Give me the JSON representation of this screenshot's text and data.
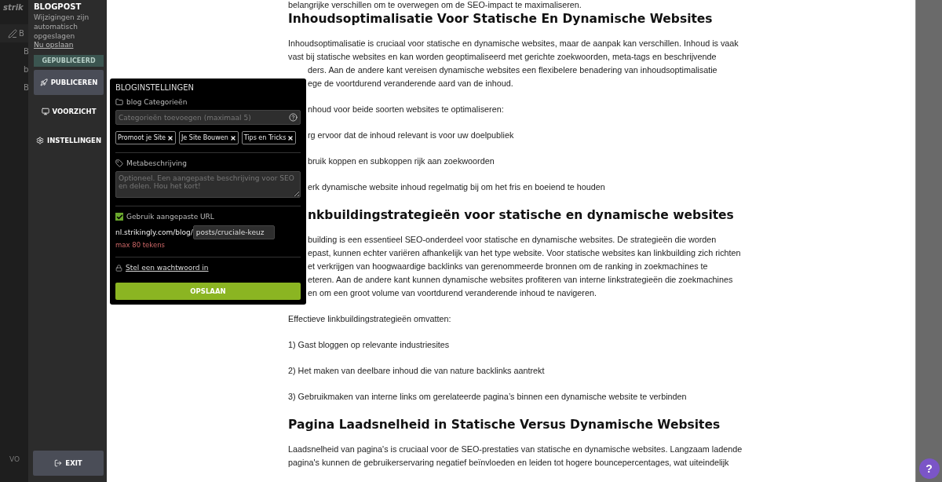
{
  "left_strip": {
    "logo": "strik",
    "items": [
      {
        "kind": "pen",
        "text": "B"
      },
      {
        "kind": "plain",
        "text": "B"
      },
      {
        "kind": "plain",
        "text": "b"
      },
      {
        "kind": "plain",
        "text": "B"
      }
    ],
    "bottom": "VO"
  },
  "sidebar": {
    "title": "BLOGPOST",
    "status": "Wijzigingen zijn automatisch opgeslagen",
    "save_link": "Nu opslaan",
    "badge": "GEPUBLICEERD",
    "buttons": [
      {
        "kind": "publish",
        "label": "PUBLICEREN"
      },
      {
        "kind": "preview",
        "label": "VOORZICHT"
      },
      {
        "kind": "settings",
        "label": "INSTELLINGEN"
      }
    ],
    "exit": "EXIT"
  },
  "popover": {
    "title": "BLOGINSTELLINGEN",
    "categories_label": "blog Categorieën",
    "categories_placeholder": "Categorieën toevoegen (maximaal 5)",
    "tags": [
      "Promoot je Site",
      "Je Site Bouwen",
      "Tips en Tricks"
    ],
    "meta_label": "Metabeschrijving",
    "meta_placeholder": "Optioneel. Een aangepaste beschrijving voor SEO en delen. Hou het kort!",
    "custom_url": {
      "label": "Gebruik aangepaste URL",
      "checked": true
    },
    "url_prefix": "nl.strikingly.com/blog/",
    "url_value": "posts/cruciale-keuz",
    "url_hint": "max 80 tekens",
    "password_link": "Stel een wachtwoord in",
    "save_button": "OPSLAAN"
  },
  "article": [
    {
      "kind": "para",
      "lines": [
        {
          "text": "belangrijke verschillen om te overwegen om de SEO-impact te maximaliseren."
        }
      ]
    },
    {
      "kind": "heading",
      "lines": [
        {
          "text": "Inhoudsoptimalisatie Voor Statische En Dynamische Websites"
        }
      ]
    },
    {
      "kind": "para",
      "lines": [
        {
          "text": "Inhoudsoptimalisatie is cruciaal voor statische en dynamische websites, maar de aanpak kan verschillen. Inhoud is vaak"
        },
        {
          "text": "vast bij statische websites en kan worden geoptimaliseerd met gerichte zoekwoorden, meta-tags en beschrijvende"
        },
        {
          "text": "ders. Aan de andere kant vereisen dynamische websites een flexibelere benadering van inhoudsoptimalisatie",
          "covered": true
        },
        {
          "text": "ege de voortdurend veranderende aard van de inhoud.",
          "covered": true
        }
      ]
    },
    {
      "kind": "para",
      "lines": [
        {
          "text": "nhoud voor beide soorten websites te optimaliseren:",
          "covered": true
        }
      ]
    },
    {
      "kind": "para",
      "lines": [
        {
          "text": "rg ervoor dat de inhoud relevant is voor uw doelpubliek",
          "covered": true
        }
      ]
    },
    {
      "kind": "para",
      "lines": [
        {
          "text": "bruik koppen en subkoppen rijk aan zoekwoorden",
          "covered": true
        }
      ]
    },
    {
      "kind": "para",
      "lines": [
        {
          "text": "erk dynamische website inhoud regelmatig bij om het fris en boeiend te houden",
          "covered": true
        }
      ]
    },
    {
      "kind": "heading",
      "lines": [
        {
          "text": "nkbuildingstrategieën voor statische en dynamische websites",
          "covered": true
        }
      ]
    },
    {
      "kind": "para",
      "lines": [
        {
          "text": "building is een essentieel SEO-onderdeel voor statische en dynamische websites. De strategieën die worden",
          "covered": true
        },
        {
          "text": "epast, kunnen echter variëren afhankelijk van het type website. Voor statische websites kan linkbuilding zich richten",
          "covered": true
        },
        {
          "text": "et verkrijgen van hoogwaardige backlinks van gerenommeerde bronnen om de ranking in zoekmachines te",
          "covered": true
        },
        {
          "text": "eteren. Aan de andere kant kunnen dynamische websites profiteren van interne linkstrategieën die zoekmachines",
          "covered": true
        },
        {
          "text": "en om een groot volume van voortdurend veranderende inhoud te navigeren.",
          "covered": true
        }
      ]
    },
    {
      "kind": "para",
      "lines": [
        {
          "text": "Effectieve linkbuildingstrategieën omvatten:"
        }
      ]
    },
    {
      "kind": "para",
      "lines": [
        {
          "text": "1) Gast bloggen op relevante industriesites"
        }
      ]
    },
    {
      "kind": "para",
      "lines": [
        {
          "text": "2) Het maken van deelbare inhoud die van nature backlinks aantrekt"
        }
      ]
    },
    {
      "kind": "para",
      "lines": [
        {
          "text": "3) Gebruikmaken van interne links om gerelateerde pagina’s binnen een dynamische website te verbinden"
        }
      ]
    },
    {
      "kind": "heading",
      "lines": [
        {
          "text": "Pagina Laadsnelheid in Statische Versus Dynamische Websites"
        }
      ]
    },
    {
      "kind": "para",
      "lines": [
        {
          "text": "Laadsnelheid van pagina's is cruciaal voor de SEO-prestaties van statische en dynamische websites. Langzaam ladende"
        },
        {
          "text": "pagina's kunnen de gebruikerservaring negatief beïnvloeden en leiden tot hogere bouncepercentages, wat uiteindelijk"
        }
      ]
    }
  ],
  "help_button": "?"
}
